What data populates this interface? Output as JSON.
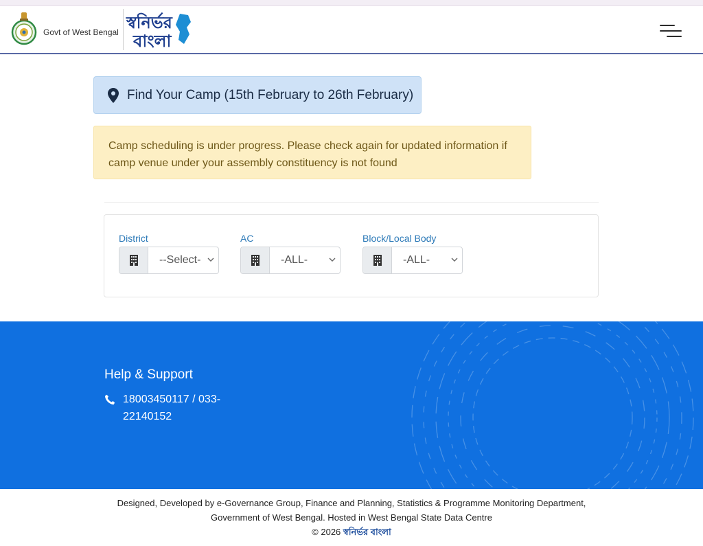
{
  "header": {
    "govt_text": "Govt of West Bengal",
    "logo_text_top": "স্বনির্ভর",
    "logo_text_bottom": "বাংলা",
    "menu_icon": "hamburger-menu-icon"
  },
  "find_camp": {
    "icon": "map-marker-icon",
    "title": "Find Your Camp (15th February to 26th February)"
  },
  "alert": {
    "text": "Camp scheduling is under progress. Please check again for updated information if camp venue under your assembly constituency is not found"
  },
  "filters": {
    "district": {
      "label": "District",
      "value": "--Select-",
      "icon": "building-icon"
    },
    "ac": {
      "label": "AC",
      "value": "-ALL-",
      "icon": "building-icon"
    },
    "block": {
      "label": "Block/Local Body",
      "value": "-ALL-",
      "icon": "building-icon"
    }
  },
  "support": {
    "title": "Help & Support",
    "phone_icon": "phone-icon",
    "phone": "18003450117 / 033-22140152"
  },
  "credits": {
    "line1": "Designed, Developed by e-Governance Group, Finance and Planning, Statistics & Programme Monitoring Department,",
    "line2": "Government of West Bengal. Hosted in West Bengal State Data Centre",
    "copyright": "© 2026",
    "brand": "স্বনির্ভর বাংলা"
  },
  "colors": {
    "footer_bg": "#1070e0",
    "info_box_bg": "#cfe2f7",
    "alert_bg": "#fdefc4",
    "label_blue": "#2d7ab8",
    "header_border": "#5a6aa6"
  }
}
